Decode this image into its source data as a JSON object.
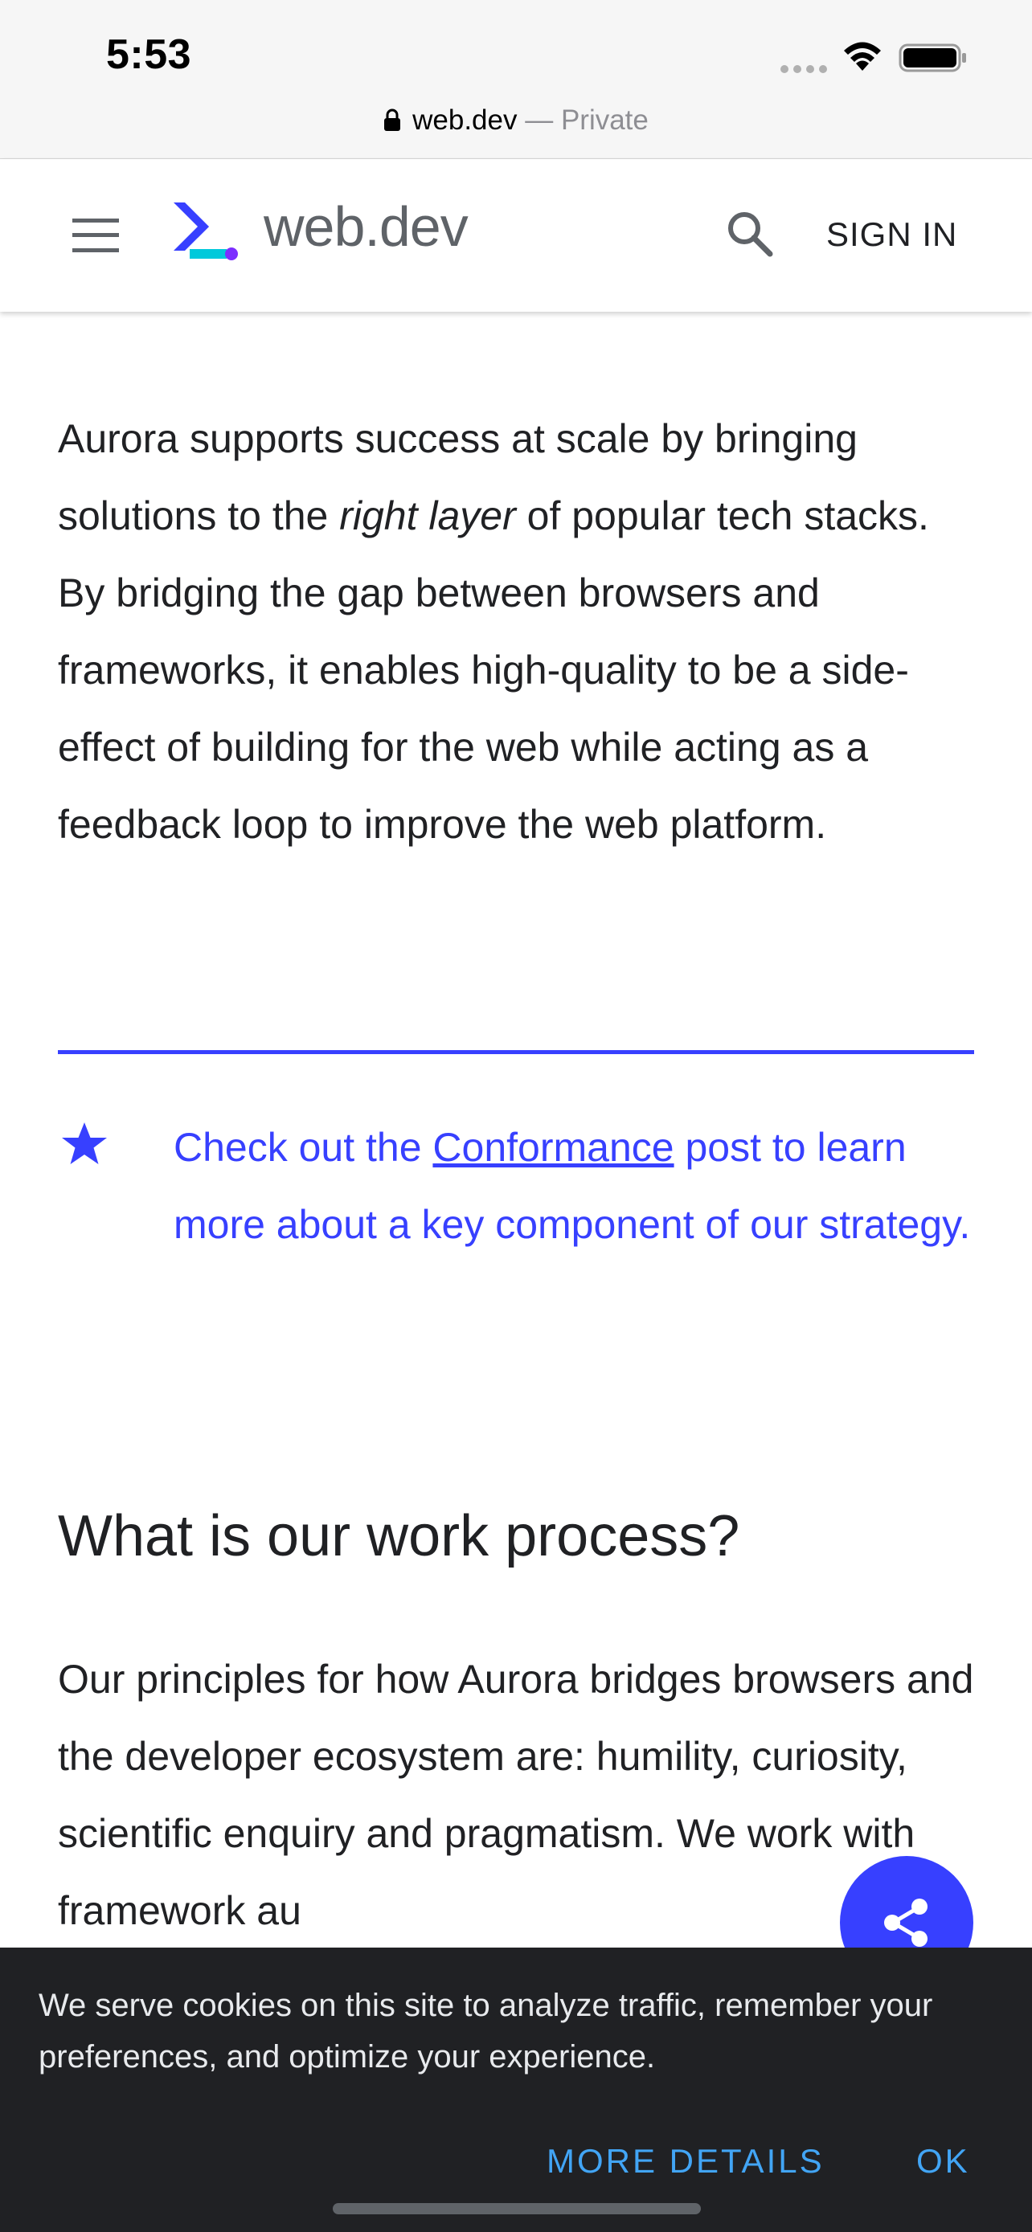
{
  "status_bar": {
    "time": "5:53"
  },
  "address_bar": {
    "domain": "web.dev",
    "separator": " — ",
    "mode": "Private"
  },
  "header": {
    "logo_text": "web.dev",
    "signin_label": "SIGN IN"
  },
  "icons": {
    "menu": "hamburger-menu-icon",
    "logo": "web-dev-logo-icon",
    "search": "search-icon",
    "star": "star-icon",
    "share": "share-icon",
    "lock": "lock-icon",
    "wifi": "wifi-icon",
    "battery": "battery-icon"
  },
  "article": {
    "para1": {
      "before": "Aurora supports success at scale by bringing solutions to the ",
      "emphasis": "right layer",
      "after": " of popular tech stacks. By bridging the gap between browsers and frameworks, it enables high-quality to be a side-effect of building for the web while acting as a feedback loop to improve the web platform."
    },
    "aside": {
      "before": "Check out the ",
      "link": "Conformance",
      "after": " post to learn more about a key component of our strategy."
    },
    "heading": "What is our work process?",
    "para2": "Our principles for how Aurora bridges browsers and the developer ecosystem are: humility, curiosity, scientific enquiry and pragmatism. We work with framework au"
  },
  "cookie_banner": {
    "text": "We serve cookies on this site to analyze traffic, remember your preferences, and optimize your experience.",
    "more_label": "MORE DETAILS",
    "ok_label": "OK"
  },
  "colors": {
    "accent": "#3740ff",
    "banner_bg": "#202124",
    "banner_action": "#42a5f5",
    "logo_teal": "#00c9db",
    "logo_purple": "#7c2eff"
  }
}
